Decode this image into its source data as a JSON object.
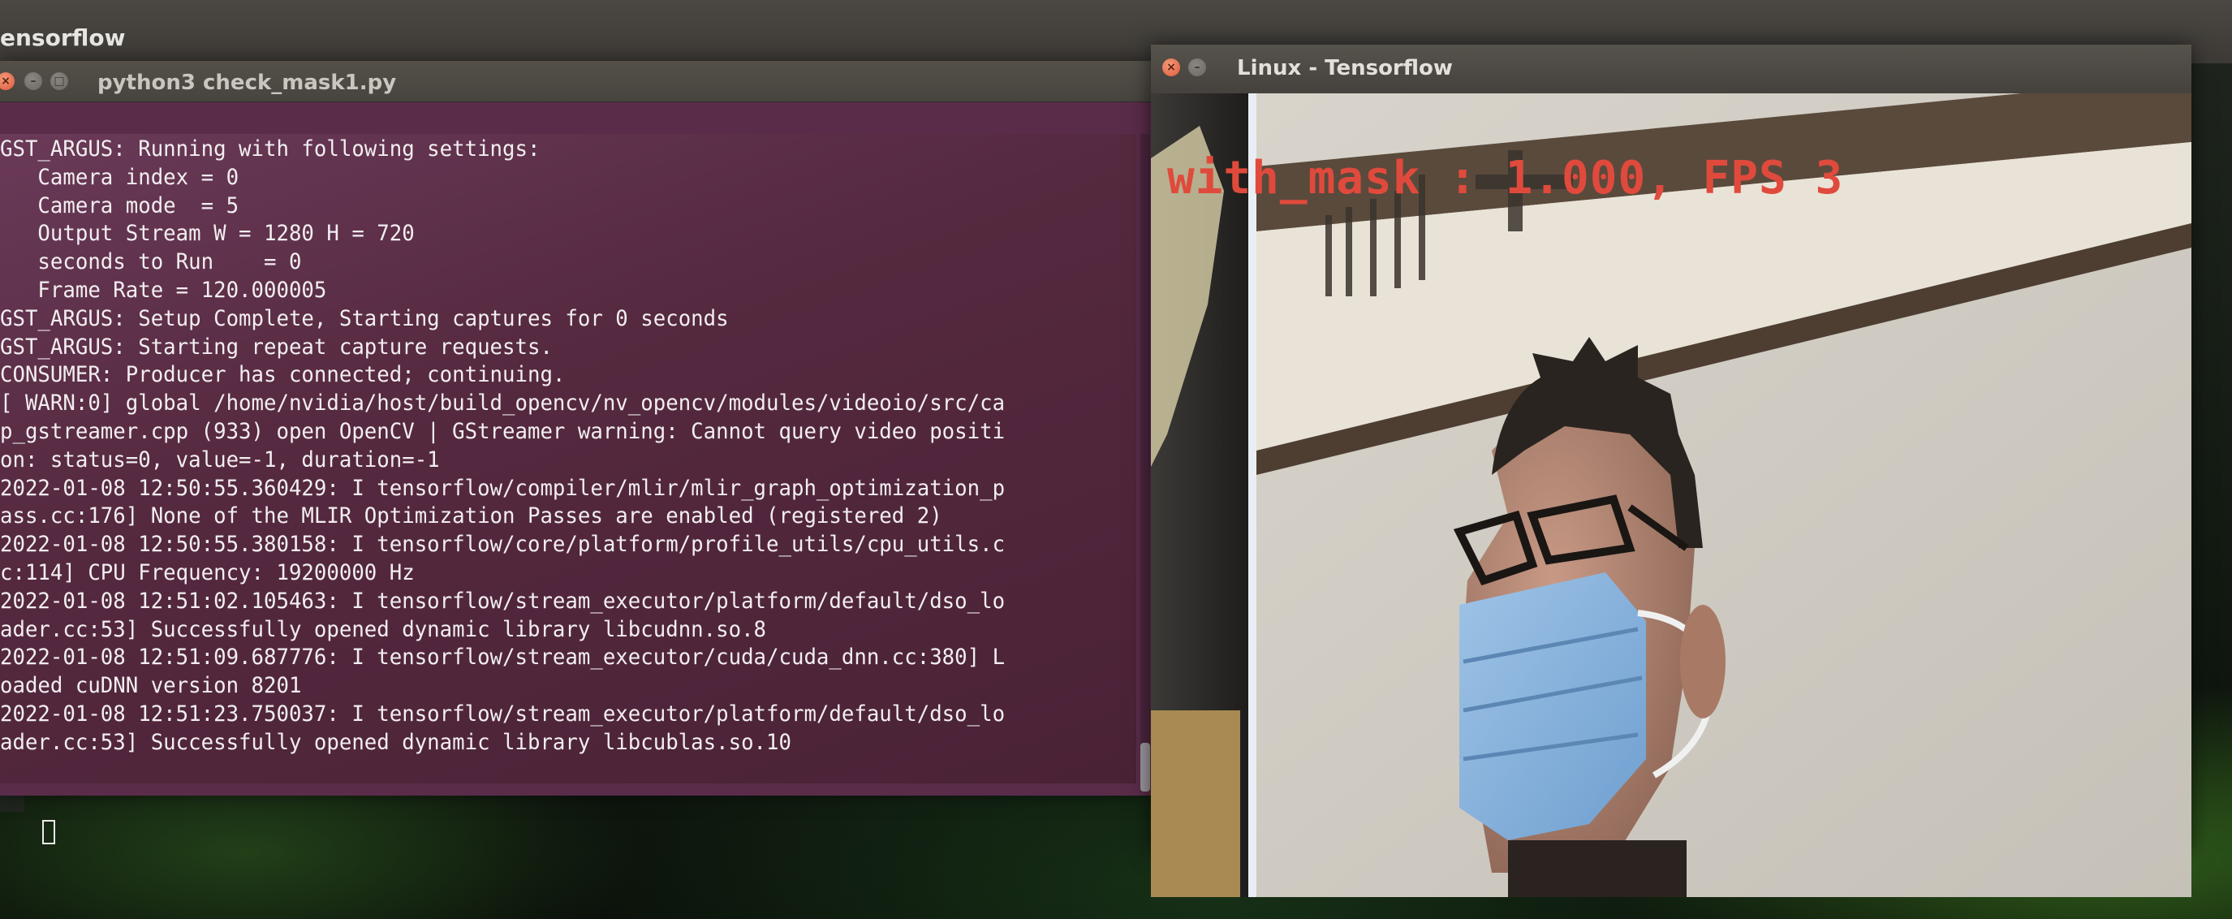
{
  "top_panel": {
    "title": "ensorflow"
  },
  "terminal": {
    "title": "python3 check_mask1.py",
    "lines": [
      "GST_ARGUS: Running with following settings:",
      "   Camera index = 0",
      "   Camera mode  = 5",
      "   Output Stream W = 1280 H = 720",
      "   seconds to Run    = 0",
      "   Frame Rate = 120.000005",
      "GST_ARGUS: Setup Complete, Starting captures for 0 seconds",
      "GST_ARGUS: Starting repeat capture requests.",
      "CONSUMER: Producer has connected; continuing.",
      "[ WARN:0] global /home/nvidia/host/build_opencv/nv_opencv/modules/videoio/src/ca",
      "p_gstreamer.cpp (933) open OpenCV | GStreamer warning: Cannot query video positi",
      "on: status=0, value=-1, duration=-1",
      "2022-01-08 12:50:55.360429: I tensorflow/compiler/mlir/mlir_graph_optimization_p",
      "ass.cc:176] None of the MLIR Optimization Passes are enabled (registered 2)",
      "2022-01-08 12:50:55.380158: I tensorflow/core/platform/profile_utils/cpu_utils.c",
      "c:114] CPU Frequency: 19200000 Hz",
      "2022-01-08 12:51:02.105463: I tensorflow/stream_executor/platform/default/dso_lo",
      "ader.cc:53] Successfully opened dynamic library libcudnn.so.8",
      "2022-01-08 12:51:09.687776: I tensorflow/stream_executor/cuda/cuda_dnn.cc:380] L",
      "oaded cuDNN version 8201",
      "2022-01-08 12:51:23.750037: I tensorflow/stream_executor/platform/default/dso_lo",
      "ader.cc:53] Successfully opened dynamic library libcublas.so.10"
    ]
  },
  "video_window": {
    "title": "Linux - Tensorflow",
    "overlay": "with_mask : 1.000, FPS 3"
  }
}
